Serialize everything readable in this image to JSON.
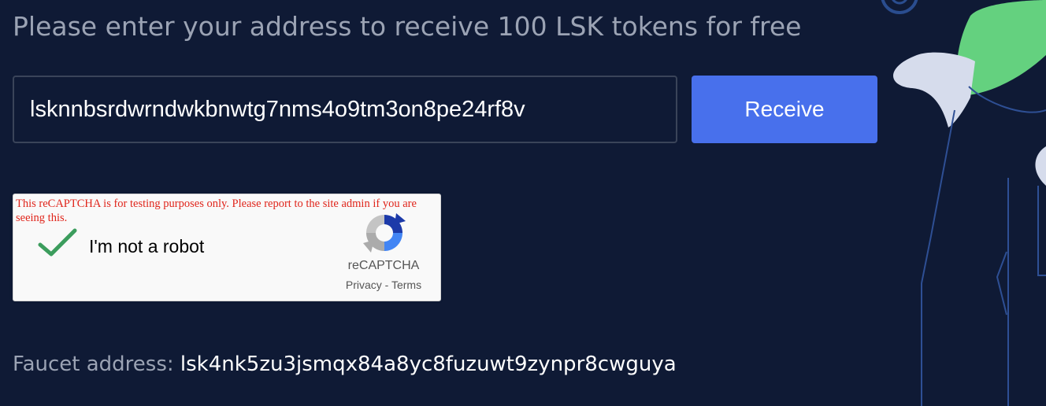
{
  "form": {
    "heading": "Please enter your address to receive 100 LSK tokens for free",
    "address_value": "lsknnbsrdwrndwkbnwtg7nms4o9tm3on8pe24rf8v",
    "receive_label": "Receive"
  },
  "recaptcha": {
    "warning": "This reCAPTCHA is for testing purposes only. Please report to the site admin if you are seeing this.",
    "checkbox_label": "I'm not a robot",
    "checked": true,
    "brand": "reCAPTCHA",
    "privacy_label": "Privacy",
    "separator": "-",
    "terms_label": "Terms"
  },
  "faucet": {
    "label": "Faucet address:",
    "address": "lsk4nk5zu3jsmqx84a8yc8fuzuwt9zynpr8cwguya"
  },
  "colors": {
    "background": "#0f1a35",
    "accent": "#4870ec",
    "muted_text": "#9ba3b4",
    "illustration_green": "#64d17f",
    "check_green": "#3c9d5d",
    "warning_red": "#e0251b"
  },
  "icons": {
    "checkmark": "checkmark-icon",
    "recaptcha_logo": "recaptcha-logo-icon"
  }
}
